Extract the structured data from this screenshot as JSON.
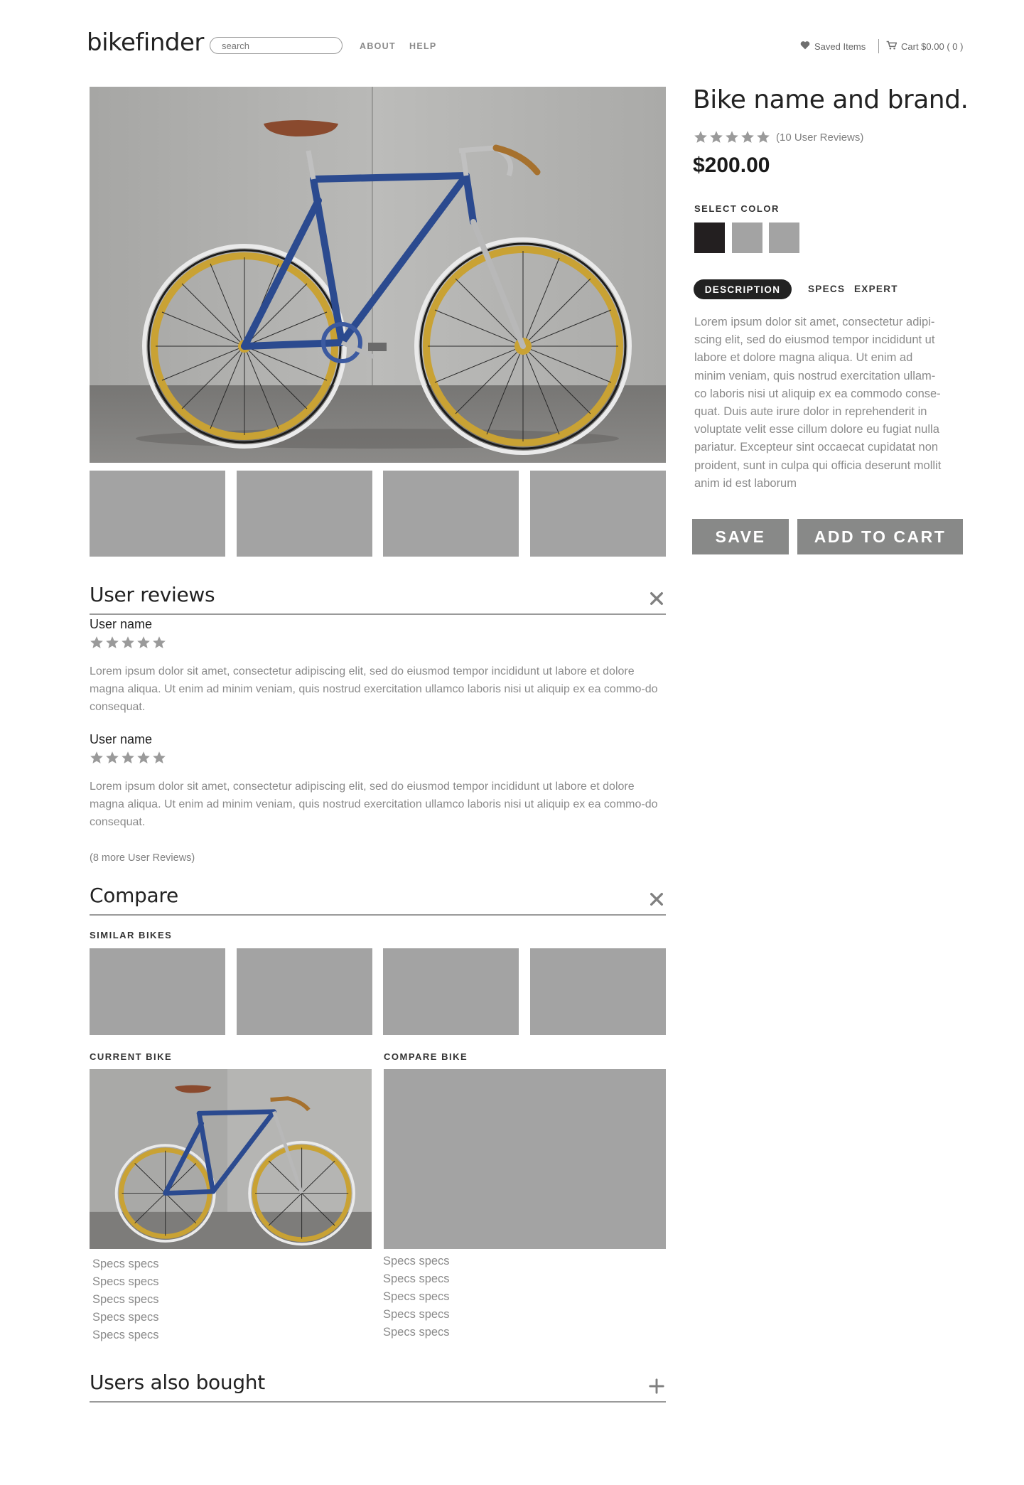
{
  "header": {
    "logo": "bikefinder",
    "search_placeholder": "search",
    "nav": [
      "ABOUT",
      "HELP"
    ],
    "saved_label": "Saved Items",
    "cart_label": "Cart $0.00 ( 0 )"
  },
  "product": {
    "title": "Bike name and brand.",
    "rating": 5,
    "reviews_label": "(10 User Reviews)",
    "price": "$200.00",
    "select_color_label": "SELECT COLOR",
    "colors": [
      "#231f20",
      "#a3a3a3",
      "#a3a3a3"
    ],
    "tabs": [
      "DESCRIPTION",
      "SPECS",
      "EXPERT"
    ],
    "active_tab": "DESCRIPTION",
    "description": "Lorem ipsum dolor sit amet, consectetur adipi-scing elit, sed do eiusmod tempor incididunt ut labore et dolore magna aliqua. Ut enim ad minim veniam, quis nostrud exercitation ullam-co laboris nisi ut aliquip ex ea commodo conse-quat. Duis aute irure dolor in reprehenderit in voluptate velit esse cillum dolore eu fugiat nulla pariatur. Excepteur sint occaecat cupidatat non proident, sunt in culpa qui officia deserunt mollit anim id est laborum",
    "save_label": "SAVE",
    "add_to_cart_label": "ADD TO CART"
  },
  "reviews": {
    "title": "User reviews",
    "items": [
      {
        "user": "User name",
        "rating": 5,
        "text": "Lorem ipsum dolor sit amet, consectetur adipiscing elit, sed do eiusmod tempor incididunt ut labore et dolore magna aliqua. Ut enim ad minim veniam, quis nostrud exercitation ullamco laboris nisi ut aliquip ex ea commo-do consequat."
      },
      {
        "user": "User name",
        "rating": 5,
        "text": "Lorem ipsum dolor sit amet, consectetur adipiscing elit, sed do eiusmod tempor incididunt ut labore et dolore magna aliqua. Ut enim ad minim veniam, quis nostrud exercitation ullamco laboris nisi ut aliquip ex ea commo-do consequat."
      }
    ],
    "more_label": "(8 more User Reviews)"
  },
  "compare": {
    "title": "Compare",
    "similar_label": "SIMILAR BIKES",
    "current_label": "CURRENT BIKE",
    "compare_label": "COMPARE BIKE",
    "current_specs": [
      "Specs specs",
      "Specs specs",
      "Specs specs",
      "Specs specs",
      "Specs specs"
    ],
    "compare_specs": [
      "Specs specs",
      "Specs specs",
      "Specs specs",
      "Specs specs",
      "Specs specs"
    ]
  },
  "also_bought": {
    "title": "Users also bought"
  },
  "colors": {
    "star": "#9a9a9a",
    "button": "#888988",
    "placeholder": "#a3a3a3",
    "bike_frame": "#2b4a8f",
    "rim": "#c9a234"
  }
}
